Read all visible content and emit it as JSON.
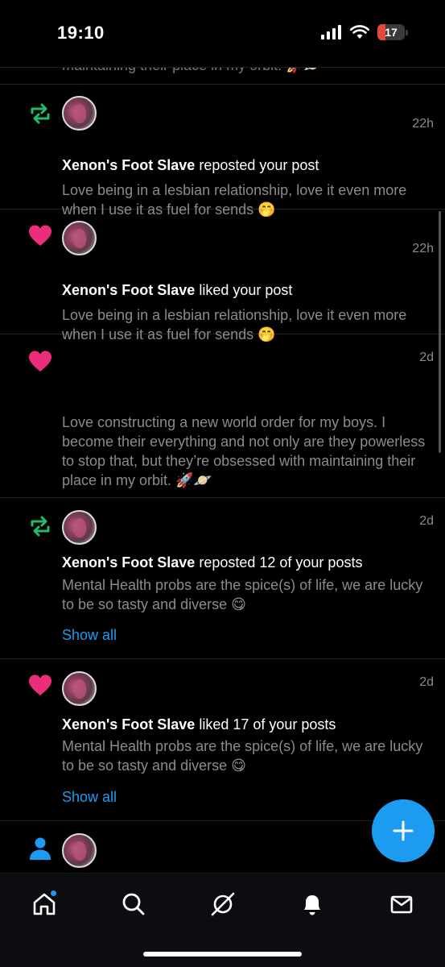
{
  "status": {
    "time": "19:10",
    "battery": "17"
  },
  "partial_text": "maintaining their place in my orbit. 🚀🪐",
  "notifications": [
    {
      "type": "repost",
      "time": "22h",
      "user": "Xenon's Foot Slave",
      "action": " reposted your post",
      "body": "Love being in a lesbian relationship, love it even more when I use it as fuel for sends 🤭"
    },
    {
      "type": "like",
      "time": "22h",
      "user": "Xenon's Foot Slave",
      "action": " liked your post",
      "body": "Love being in a lesbian relationship, love it even more when I use it as fuel for sends 🤭"
    },
    {
      "type": "like",
      "time": "2d",
      "user": "",
      "action": "",
      "body": "Love constructing a new world order for my boys. I become their everything and not only are they powerless to stop that, but they’re obsessed with maintaining their place in my orbit. 🚀🪐"
    },
    {
      "type": "repost",
      "time": "2d",
      "user": "Xenon's Foot Slave",
      "action": " reposted 12 of your posts",
      "body": "Mental Health probs are the spice(s) of life, we are lucky to be so tasty and diverse 😋",
      "show_all": "Show all"
    },
    {
      "type": "like",
      "time": "2d",
      "user": "Xenon's Foot Slave",
      "action": " liked 17 of your posts",
      "body": "Mental Health probs are the spice(s) of life, we are lucky to be so tasty and diverse 😋",
      "show_all": "Show all"
    },
    {
      "type": "follow",
      "time": "",
      "user": "",
      "action": "",
      "body": ""
    }
  ],
  "fab": {
    "icon": "plus-icon"
  },
  "tabs": [
    {
      "icon": "home-icon",
      "has_badge": true
    },
    {
      "icon": "search-icon"
    },
    {
      "icon": "feeds-icon"
    },
    {
      "icon": "bell-icon"
    },
    {
      "icon": "mail-icon"
    }
  ],
  "colors": {
    "accent": "#1d9bf0",
    "like": "#ec2d7a",
    "repost": "#20bc6b",
    "muted": "#8b8b8b"
  }
}
